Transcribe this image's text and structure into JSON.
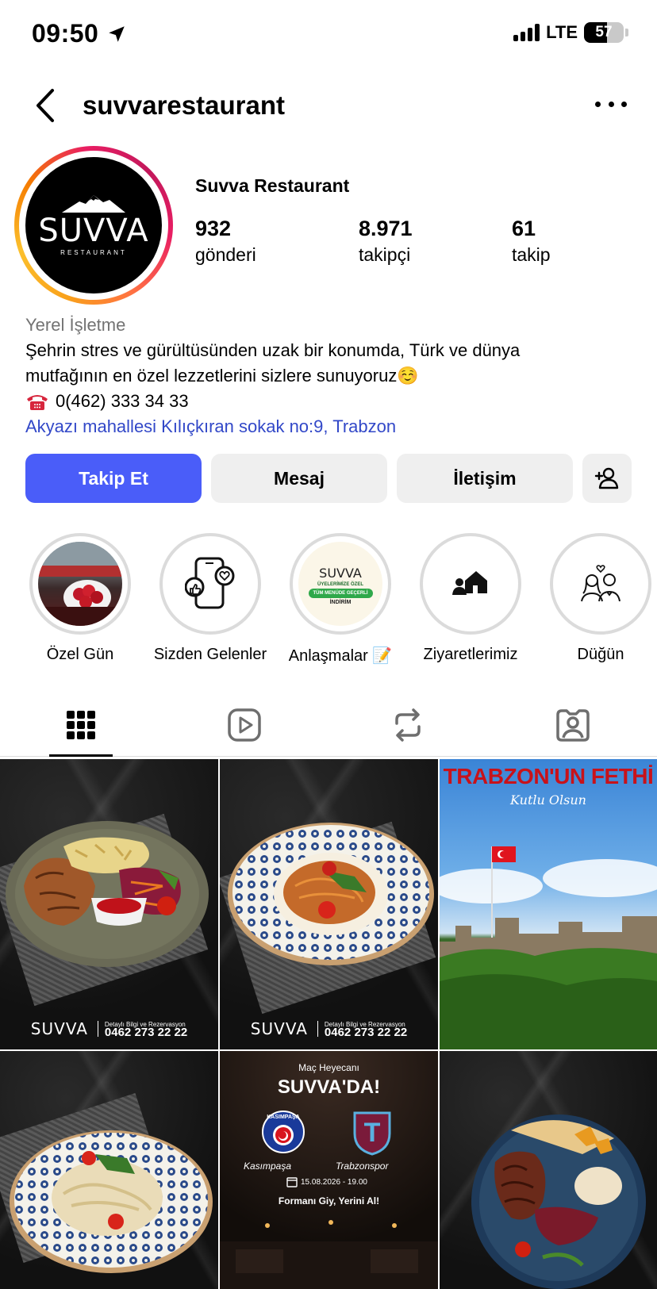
{
  "status_bar": {
    "time": "09:50",
    "network": "LTE",
    "battery": "57",
    "battery_level": 0.57
  },
  "header": {
    "username": "suvvarestaurant"
  },
  "profile": {
    "display_name": "Suvva Restaurant",
    "logo": {
      "word": "SUVVA",
      "sub": "RESTAURANT"
    },
    "stats": [
      {
        "value": "932",
        "label": "gönderi"
      },
      {
        "value": "8.971",
        "label": "takipçi"
      },
      {
        "value": "61",
        "label": "takip"
      }
    ],
    "category": "Yerel İşletme",
    "bio_line1": "Şehrin stres ve gürültüsünden uzak bir konumda, Türk ve dünya",
    "bio_line2": "mutfağının en özel lezzetlerini sizlere sunuyoruz☺️",
    "phone": "0(462) 333 34 33",
    "address": "Akyazı mahallesi Kılıçkıran sokak no:9, Trabzon"
  },
  "actions": {
    "follow": "Takip Et",
    "message": "Mesaj",
    "contact": "İletişim"
  },
  "highlights": [
    {
      "label": "Özel Gün"
    },
    {
      "label": "Sizden Gelenler"
    },
    {
      "label": "Anlaşmalar 📝"
    },
    {
      "label": "Ziyaretlerimiz"
    },
    {
      "label": "Düğün"
    }
  ],
  "highlight_badge": {
    "word": "SUVVA",
    "line1": "ÜYELERİMİZE ÖZEL",
    "line2": "TÜM MENÜDE GEÇERLİ",
    "line3": "İNDİRİM"
  },
  "tabs": [
    {
      "icon": "grid-icon"
    },
    {
      "icon": "reels-icon"
    },
    {
      "icon": "reposts-icon"
    },
    {
      "icon": "tagged-icon"
    }
  ],
  "posts": {
    "brand_word": "SUVVA",
    "info_label": "Detaylı Bilgi ve Rezervasyon",
    "info_phone": "0462 273 22 22",
    "fetih_title": "TRABZON'UN FETHİ",
    "fetih_sub": "Kutlu Olsun",
    "match_kicker": "Maç Heyecanı",
    "match_title": "SUVVA'DA!",
    "team_home": "Kasımpaşa",
    "team_away": "Trabzonspor",
    "match_date": "15.08.2026 - 19.00",
    "match_slogan": "Formanı Giy, Yerini Al!",
    "home_badge": "KASIMPAŞA"
  },
  "colors": {
    "follow_button": "#4a5df9",
    "link": "#3248c8",
    "muted": "#737373"
  }
}
